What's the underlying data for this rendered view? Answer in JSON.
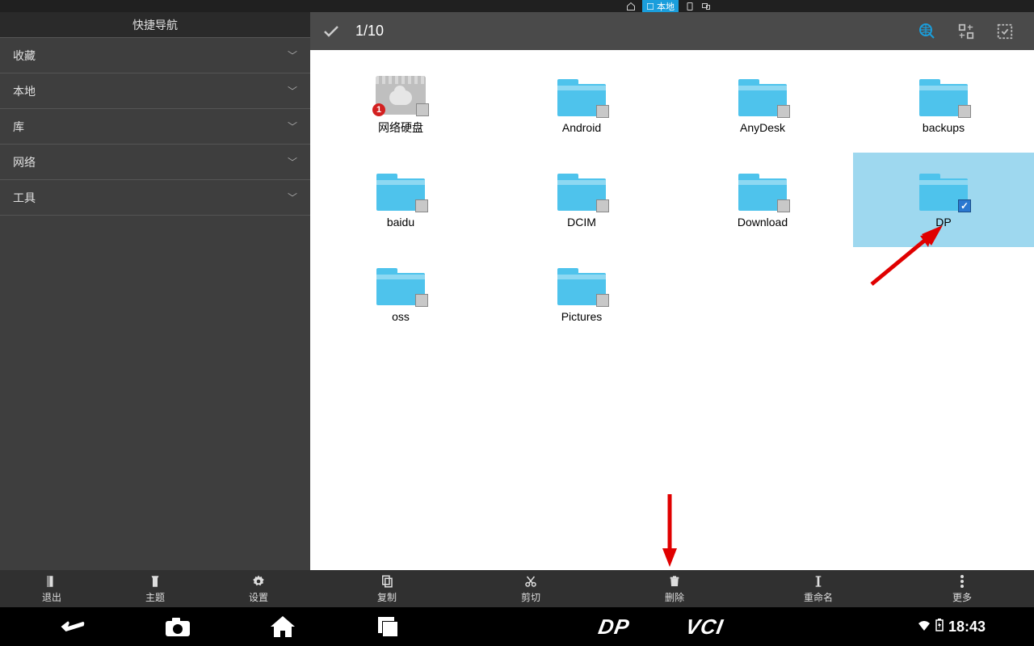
{
  "top": {
    "local_label": "本地"
  },
  "sidebar": {
    "title": "快捷导航",
    "items": [
      {
        "label": "收藏"
      },
      {
        "label": "本地"
      },
      {
        "label": "库"
      },
      {
        "label": "网络"
      },
      {
        "label": "工具"
      }
    ]
  },
  "header": {
    "selection_count": "1/10"
  },
  "grid": {
    "items": [
      {
        "label": "网络硬盘",
        "type": "netdisk",
        "badge": "1"
      },
      {
        "label": "Android",
        "type": "folder"
      },
      {
        "label": "AnyDesk",
        "type": "folder"
      },
      {
        "label": "backups",
        "type": "folder"
      },
      {
        "label": "baidu",
        "type": "folder"
      },
      {
        "label": "DCIM",
        "type": "folder"
      },
      {
        "label": "Download",
        "type": "folder"
      },
      {
        "label": "DP",
        "type": "folder",
        "selected": true
      },
      {
        "label": "oss",
        "type": "folder"
      },
      {
        "label": "Pictures",
        "type": "folder"
      }
    ]
  },
  "toolbar": {
    "left": [
      {
        "label": "退出",
        "icon": "exit"
      },
      {
        "label": "主题",
        "icon": "theme"
      },
      {
        "label": "设置",
        "icon": "settings"
      }
    ],
    "right": [
      {
        "label": "复制",
        "icon": "copy"
      },
      {
        "label": "剪切",
        "icon": "cut"
      },
      {
        "label": "删除",
        "icon": "delete"
      },
      {
        "label": "重命名",
        "icon": "rename"
      },
      {
        "label": "更多",
        "icon": "more"
      }
    ]
  },
  "navlogo": {
    "dp": "DP",
    "vci": "VCI"
  },
  "status": {
    "time": "18:43"
  }
}
